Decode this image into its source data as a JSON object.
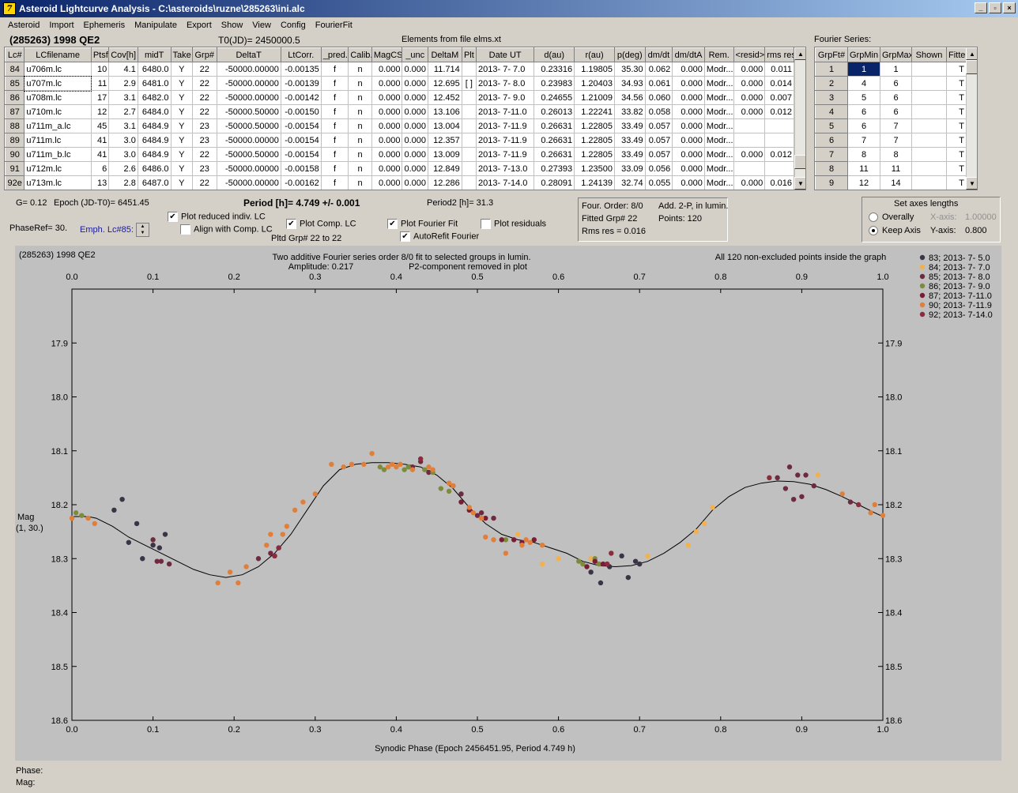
{
  "window": {
    "title": "Asteroid Lightcurve Analysis - C:\\asteroids\\ruzne\\285263\\ini.alc",
    "app_icon_glyph": "7"
  },
  "menu": [
    "Asteroid",
    "Import",
    "Ephemeris",
    "Manipulate",
    "Export",
    "Show",
    "View",
    "Config",
    "FourierFit"
  ],
  "header": {
    "object": "(285263) 1998 QE2",
    "t0": "T0(JD)= 2450000.5",
    "elements": "Elements from file elms.xt",
    "fourier_label": "Fourier Series:"
  },
  "lc_table": {
    "columns": [
      "Lc#",
      "LCfilename",
      "Ptsf",
      "Cov[h]",
      "midT",
      "Take",
      "Grp#",
      "DeltaT",
      "LtCorr.",
      "_pred.",
      "Calib.",
      "MagCS",
      "_unc",
      "DeltaM",
      "Plt",
      "Date UT",
      "d(au)",
      "r(au)",
      "p(deg)",
      "dm/dt",
      "dm/dtA",
      "Rem.",
      "<resid>",
      "rms res"
    ],
    "rows": [
      [
        "84",
        "u706m.lc",
        "10",
        "4.1",
        "6480.0",
        "Y",
        "22",
        "-50000.00000",
        "-0.00135",
        "f",
        "n",
        "0.000",
        "0.000",
        "11.714",
        "",
        "2013- 7- 7.0",
        "0.23316",
        "1.19805",
        "35.30",
        "0.062",
        "0.000",
        "Modr...",
        "0.000",
        "0.011"
      ],
      [
        "85",
        "u707m.lc",
        "11",
        "2.9",
        "6481.0",
        "Y",
        "22",
        "-50000.00000",
        "-0.00139",
        "f",
        "n",
        "0.000",
        "0.000",
        "12.695",
        "[ ]",
        "2013- 7- 8.0",
        "0.23983",
        "1.20403",
        "34.93",
        "0.061",
        "0.000",
        "Modr...",
        "0.000",
        "0.014"
      ],
      [
        "86",
        "u708m.lc",
        "17",
        "3.1",
        "6482.0",
        "Y",
        "22",
        "-50000.00000",
        "-0.00142",
        "f",
        "n",
        "0.000",
        "0.000",
        "12.452",
        "",
        "2013- 7- 9.0",
        "0.24655",
        "1.21009",
        "34.56",
        "0.060",
        "0.000",
        "Modr...",
        "0.000",
        "0.007"
      ],
      [
        "87",
        "u710m.lc",
        "12",
        "2.7",
        "6484.0",
        "Y",
        "22",
        "-50000.50000",
        "-0.00150",
        "f",
        "n",
        "0.000",
        "0.000",
        "13.106",
        "",
        "2013- 7-11.0",
        "0.26013",
        "1.22241",
        "33.82",
        "0.058",
        "0.000",
        "Modr...",
        "0.000",
        "0.012"
      ],
      [
        "88",
        "u711m_a.lc",
        "45",
        "3.1",
        "6484.9",
        "Y",
        "23",
        "-50000.50000",
        "-0.00154",
        "f",
        "n",
        "0.000",
        "0.000",
        "13.004",
        "",
        "2013- 7-11.9",
        "0.26631",
        "1.22805",
        "33.49",
        "0.057",
        "0.000",
        "Modr...",
        "",
        ""
      ],
      [
        "89",
        "u711m.lc",
        "41",
        "3.0",
        "6484.9",
        "Y",
        "23",
        "-50000.00000",
        "-0.00154",
        "f",
        "n",
        "0.000",
        "0.000",
        "12.357",
        "",
        "2013- 7-11.9",
        "0.26631",
        "1.22805",
        "33.49",
        "0.057",
        "0.000",
        "Modr...",
        "",
        ""
      ],
      [
        "90",
        "u711m_b.lc",
        "41",
        "3.0",
        "6484.9",
        "Y",
        "22",
        "-50000.50000",
        "-0.00154",
        "f",
        "n",
        "0.000",
        "0.000",
        "13.009",
        "",
        "2013- 7-11.9",
        "0.26631",
        "1.22805",
        "33.49",
        "0.057",
        "0.000",
        "Modr...",
        "0.000",
        "0.012"
      ],
      [
        "91",
        "u712m.lc",
        "6",
        "2.6",
        "6486.0",
        "Y",
        "23",
        "-50000.00000",
        "-0.00158",
        "f",
        "n",
        "0.000",
        "0.000",
        "12.849",
        "",
        "2013- 7-13.0",
        "0.27393",
        "1.23500",
        "33.09",
        "0.056",
        "0.000",
        "Modr...",
        "",
        ""
      ],
      [
        "92e",
        "u713m.lc",
        "13",
        "2.8",
        "6487.0",
        "Y",
        "22",
        "-50000.00000",
        "-0.00162",
        "f",
        "n",
        "0.000",
        "0.000",
        "12.286",
        "",
        "2013- 7-14.0",
        "0.28091",
        "1.24139",
        "32.74",
        "0.055",
        "0.000",
        "Modr...",
        "0.000",
        "0.016"
      ]
    ]
  },
  "fourier_table": {
    "columns": [
      "GrpFt#",
      "GrpMin",
      "GrpMax",
      "Shown",
      "Fitte"
    ],
    "rows": [
      [
        "1",
        "1",
        "1",
        "",
        "T"
      ],
      [
        "2",
        "4",
        "6",
        "",
        "T"
      ],
      [
        "3",
        "5",
        "6",
        "",
        "T"
      ],
      [
        "4",
        "6",
        "6",
        "",
        "T"
      ],
      [
        "5",
        "6",
        "7",
        "",
        "T"
      ],
      [
        "6",
        "7",
        "7",
        "",
        "T"
      ],
      [
        "7",
        "8",
        "8",
        "",
        "T"
      ],
      [
        "8",
        "11",
        "11",
        "",
        "T"
      ],
      [
        "9",
        "12",
        "14",
        "",
        "T"
      ]
    ]
  },
  "controls": {
    "g": "G= 0.12",
    "epoch": "Epoch (JD-T0)= 6451.45",
    "period": "Period [h]= 4.749 +/- 0.001",
    "period2": "Period2 [h]= 31.3",
    "phaseref": "PhaseRef= 30.",
    "emph": "Emph. Lc#85:",
    "plot_reduced": "Plot reduced indiv. LC",
    "align": "Align with Comp. LC",
    "plot_comp": "Plot Comp. LC",
    "pltd_grp": "Pltd Grp#  22 to   22",
    "plot_fourier": "Plot Fourier Fit",
    "autorefit": "AutoRefit Fourier",
    "plot_residuals": "Plot residuals",
    "four_order": "Four. Order:  8/0",
    "add_2p": "Add. 2-P, in lumin.",
    "fitted_grp": "Fitted Grp# 22",
    "points": "Points: 120",
    "rms": "Rms res      = 0.016",
    "axes_title": "Set axes lengths",
    "overally": "Overally",
    "keep_axis": "Keep Axis",
    "x_axis_label": "X-axis:",
    "x_axis_val": "1.00000",
    "y_axis_label": "Y-axis:",
    "y_axis_val": "0.800"
  },
  "plot_text": {
    "object": "(285263) 1998 QE2",
    "title1": "Two additive Fourier series order 8/0 fit to selected groups in lumin.",
    "amplitude": "Amplitude: 0.217",
    "p2note": "P2-component removed in plot",
    "allpoints": "All 120 non-excluded points inside the graph",
    "ylabel1": "Mag",
    "ylabel2": "(1, 30.)",
    "xlabel": "Synodic Phase (Epoch 2456451.95, Period 4.749 h)"
  },
  "footer": {
    "phase": "Phase:",
    "mag": "Mag:"
  },
  "chart_data": {
    "type": "scatter",
    "xlim": [
      0.0,
      1.0
    ],
    "ylim": [
      18.6,
      17.8
    ],
    "xticks": [
      "0.0",
      "0.1",
      "0.2",
      "0.3",
      "0.4",
      "0.5",
      "0.6",
      "0.7",
      "0.8",
      "0.9",
      "1.0"
    ],
    "yticks": [
      "17.9",
      "18.0",
      "18.1",
      "18.2",
      "18.3",
      "18.4",
      "18.5",
      "18.6"
    ],
    "background": "#c0c0c0",
    "series": [
      {
        "name": "83; 2013- 7- 5.0",
        "color": "#3b3346",
        "points": [
          [
            0.052,
            18.21
          ],
          [
            0.062,
            18.19
          ],
          [
            0.07,
            18.27
          ],
          [
            0.08,
            18.235
          ],
          [
            0.087,
            18.3
          ],
          [
            0.1,
            18.275
          ],
          [
            0.108,
            18.28
          ],
          [
            0.115,
            18.255
          ],
          [
            0.64,
            18.325
          ],
          [
            0.652,
            18.345
          ],
          [
            0.663,
            18.315
          ],
          [
            0.678,
            18.295
          ],
          [
            0.686,
            18.335
          ],
          [
            0.695,
            18.305
          ],
          [
            0.7,
            18.31
          ]
        ]
      },
      {
        "name": "84; 2013- 7- 7.0",
        "color": "#f2b14c",
        "points": [
          [
            0.55,
            18.255
          ],
          [
            0.58,
            18.31
          ],
          [
            0.6,
            18.3
          ],
          [
            0.64,
            18.3
          ],
          [
            0.71,
            18.295
          ],
          [
            0.76,
            18.275
          ],
          [
            0.77,
            18.25
          ],
          [
            0.78,
            18.235
          ],
          [
            0.79,
            18.205
          ],
          [
            0.92,
            18.145
          ]
        ]
      },
      {
        "name": "85; 2013- 7- 8.0",
        "color": "#6e2b3f",
        "points": [
          [
            0.1,
            18.265
          ],
          [
            0.105,
            18.305
          ],
          [
            0.11,
            18.305
          ],
          [
            0.12,
            18.31
          ],
          [
            0.23,
            18.3
          ],
          [
            0.245,
            18.29
          ],
          [
            0.25,
            18.295
          ],
          [
            0.255,
            18.28
          ],
          [
            0.42,
            18.13
          ],
          [
            0.43,
            18.12
          ],
          [
            0.44,
            18.14
          ],
          [
            0.47,
            18.165
          ],
          [
            0.48,
            18.18
          ],
          [
            0.5,
            18.22
          ],
          [
            0.505,
            18.215
          ],
          [
            0.52,
            18.225
          ],
          [
            0.87,
            18.15
          ],
          [
            0.88,
            18.17
          ],
          [
            0.885,
            18.13
          ],
          [
            0.89,
            18.19
          ],
          [
            0.895,
            18.145
          ],
          [
            0.9,
            18.185
          ],
          [
            0.905,
            18.145
          ],
          [
            0.915,
            18.165
          ],
          [
            0.96,
            18.195
          ]
        ]
      },
      {
        "name": "86; 2013- 7- 9.0",
        "color": "#7d8c3c",
        "points": [
          [
            0.005,
            18.215
          ],
          [
            0.012,
            18.22
          ],
          [
            0.38,
            18.13
          ],
          [
            0.385,
            18.135
          ],
          [
            0.41,
            18.135
          ],
          [
            0.415,
            18.13
          ],
          [
            0.435,
            18.135
          ],
          [
            0.445,
            18.14
          ],
          [
            0.455,
            18.17
          ],
          [
            0.465,
            18.175
          ],
          [
            0.535,
            18.265
          ],
          [
            0.625,
            18.305
          ],
          [
            0.63,
            18.31
          ],
          [
            0.645,
            18.3
          ],
          [
            0.65,
            18.31
          ]
        ]
      },
      {
        "name": "87; 2013- 7-11.0",
        "color": "#7a1d33",
        "points": [
          [
            0.48,
            18.195
          ],
          [
            0.49,
            18.21
          ],
          [
            0.51,
            18.225
          ],
          [
            0.53,
            18.265
          ],
          [
            0.545,
            18.265
          ],
          [
            0.555,
            18.27
          ],
          [
            0.57,
            18.265
          ],
          [
            0.635,
            18.315
          ],
          [
            0.645,
            18.305
          ],
          [
            0.655,
            18.31
          ]
        ]
      },
      {
        "name": "90; 2013- 7-11.9",
        "color": "#e07f3a",
        "points": [
          [
            0.0,
            18.225
          ],
          [
            0.02,
            18.225
          ],
          [
            0.028,
            18.235
          ],
          [
            0.18,
            18.345
          ],
          [
            0.195,
            18.325
          ],
          [
            0.205,
            18.345
          ],
          [
            0.215,
            18.315
          ],
          [
            0.24,
            18.275
          ],
          [
            0.245,
            18.255
          ],
          [
            0.26,
            18.255
          ],
          [
            0.265,
            18.24
          ],
          [
            0.275,
            18.21
          ],
          [
            0.285,
            18.195
          ],
          [
            0.3,
            18.18
          ],
          [
            0.32,
            18.125
          ],
          [
            0.335,
            18.13
          ],
          [
            0.345,
            18.125
          ],
          [
            0.36,
            18.125
          ],
          [
            0.37,
            18.105
          ],
          [
            0.39,
            18.13
          ],
          [
            0.395,
            18.125
          ],
          [
            0.4,
            18.13
          ],
          [
            0.405,
            18.125
          ],
          [
            0.42,
            18.135
          ],
          [
            0.44,
            18.13
          ],
          [
            0.445,
            18.135
          ],
          [
            0.465,
            18.16
          ],
          [
            0.47,
            18.165
          ],
          [
            0.49,
            18.205
          ],
          [
            0.495,
            18.215
          ],
          [
            0.505,
            18.225
          ],
          [
            0.51,
            18.26
          ],
          [
            0.52,
            18.265
          ],
          [
            0.535,
            18.29
          ],
          [
            0.555,
            18.275
          ],
          [
            0.56,
            18.265
          ],
          [
            0.565,
            18.27
          ],
          [
            0.58,
            18.275
          ],
          [
            0.95,
            18.18
          ],
          [
            0.985,
            18.215
          ],
          [
            0.99,
            18.2
          ],
          [
            1.0,
            18.22
          ]
        ]
      },
      {
        "name": "92; 2013- 7-14.0",
        "color": "#8b2b3c",
        "points": [
          [
            0.25,
            18.295
          ],
          [
            0.255,
            18.28
          ],
          [
            0.43,
            18.115
          ],
          [
            0.665,
            18.29
          ],
          [
            0.66,
            18.31
          ],
          [
            0.86,
            18.15
          ],
          [
            0.97,
            18.2
          ]
        ]
      }
    ],
    "fourier_curve": [
      [
        0.0,
        18.222
      ],
      [
        0.02,
        18.222
      ],
      [
        0.03,
        18.225
      ],
      [
        0.05,
        18.24
      ],
      [
        0.07,
        18.26
      ],
      [
        0.09,
        18.275
      ],
      [
        0.11,
        18.29
      ],
      [
        0.13,
        18.305
      ],
      [
        0.15,
        18.32
      ],
      [
        0.17,
        18.33
      ],
      [
        0.19,
        18.335
      ],
      [
        0.21,
        18.33
      ],
      [
        0.23,
        18.315
      ],
      [
        0.25,
        18.29
      ],
      [
        0.27,
        18.255
      ],
      [
        0.29,
        18.21
      ],
      [
        0.31,
        18.165
      ],
      [
        0.33,
        18.135
      ],
      [
        0.35,
        18.125
      ],
      [
        0.37,
        18.122
      ],
      [
        0.39,
        18.122
      ],
      [
        0.41,
        18.125
      ],
      [
        0.43,
        18.13
      ],
      [
        0.45,
        18.145
      ],
      [
        0.47,
        18.17
      ],
      [
        0.49,
        18.205
      ],
      [
        0.51,
        18.235
      ],
      [
        0.53,
        18.255
      ],
      [
        0.55,
        18.265
      ],
      [
        0.57,
        18.27
      ],
      [
        0.59,
        18.28
      ],
      [
        0.61,
        18.29
      ],
      [
        0.63,
        18.305
      ],
      [
        0.65,
        18.313
      ],
      [
        0.67,
        18.315
      ],
      [
        0.69,
        18.313
      ],
      [
        0.71,
        18.305
      ],
      [
        0.73,
        18.29
      ],
      [
        0.75,
        18.27
      ],
      [
        0.77,
        18.245
      ],
      [
        0.79,
        18.21
      ],
      [
        0.81,
        18.185
      ],
      [
        0.83,
        18.168
      ],
      [
        0.85,
        18.16
      ],
      [
        0.87,
        18.156
      ],
      [
        0.89,
        18.157
      ],
      [
        0.91,
        18.162
      ],
      [
        0.93,
        18.172
      ],
      [
        0.95,
        18.185
      ],
      [
        0.97,
        18.2
      ],
      [
        0.99,
        18.215
      ],
      [
        1.0,
        18.222
      ]
    ]
  }
}
